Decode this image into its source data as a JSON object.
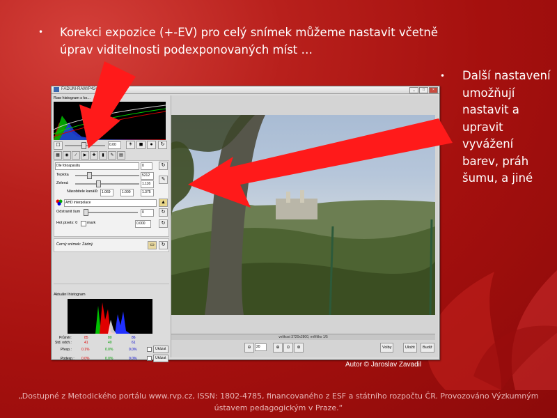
{
  "slide": {
    "bullet1": "Korekci expozice (+-EV) pro celý snímek můžeme nastavit včetně úprav viditelnosti podexponovaných míst …",
    "bullet2": "Další nastavení umožňují nastavit a upravit vyvážení barev, práh šumu, a jiné",
    "author": "Autor © Jaroslav Zavadil",
    "footer": "„Dostupné z Metodického portálu www.rvp.cz, ISSN: 1802-4785, financovaného z ESF a státního rozpočtu ČR. Provozováno Výzkumným ústavem pedagogickým v Praze.“",
    "bullet_glyph": "•",
    "arrow_color": "#ff1a1a"
  },
  "window": {
    "title": "FADUM-RAW/P424..."
  },
  "left_panel": {
    "raw_histogram_label": "Raw histogram s ko...",
    "exposure_value": "0.00",
    "white_balance_select": "Dle fotoaparátu",
    "wb_value": "0",
    "teplota_label": "Teplota",
    "teplota_value": "5212",
    "zelena_label": "Zelená",
    "zelena_value": "1.116",
    "nasobitele_label": "Násobitele kanálů:",
    "nasobitele_values": [
      "1.069",
      "1.000",
      "1.375"
    ],
    "interpolation_select": "AHD interpolace",
    "noise_label": "Odstranit šum",
    "noise_value": "0",
    "hot_pixels_label": "Hot pixels: 0",
    "mark_label": "mark",
    "hot_value": "0.000",
    "dark_frame_label": "Černý snímek: Žádný",
    "actual_histogram_label": "Aktuální histogram",
    "stats": {
      "prumer_label": "Průměr:",
      "prumer": [
        "85",
        "80",
        "86"
      ],
      "std_label": "Std. odch.:",
      "std": [
        "41",
        "40",
        "61"
      ],
      "prexp_label": "Přexp.:",
      "prexp": [
        "0.1%",
        "0.0%",
        "0.0%"
      ],
      "podexp_label": "Podexp.:",
      "podexp": [
        "0.0%",
        "0.0%",
        "0.0%"
      ],
      "show_label": "Ukázat",
      "colors": [
        "#e00000",
        "#00a000",
        "#0000d0"
      ]
    }
  },
  "right_panel": {
    "status": "velikost 3720x2800, měřítko 1/5",
    "zoom_value": "20",
    "options_button": "Volby",
    "save_button": "Uložit",
    "close_button": "Budiž"
  }
}
